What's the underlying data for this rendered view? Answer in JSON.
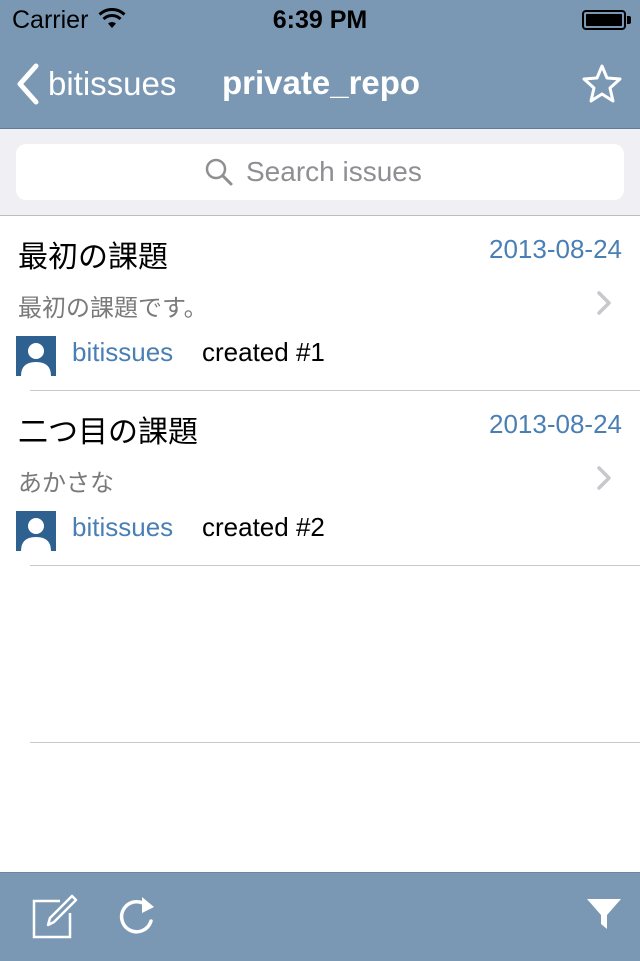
{
  "status_bar": {
    "carrier": "Carrier",
    "time": "6:39 PM",
    "wifi_icon": "wifi-icon",
    "battery_icon": "battery-icon"
  },
  "nav": {
    "back_label": "bitissues",
    "title": "private_repo",
    "back_icon": "chevron-left-icon",
    "star_icon": "star-icon"
  },
  "search": {
    "placeholder": "Search issues",
    "value": ""
  },
  "issues": [
    {
      "title": "最初の課題",
      "date": "2013-08-24",
      "description": "最初の課題です。",
      "user": "bitissues",
      "action": "created #1"
    },
    {
      "title": "二つ目の課題",
      "date": "2013-08-24",
      "description": "あかさな",
      "user": "bitissues",
      "action": "created #2"
    }
  ],
  "toolbar": {
    "compose_icon": "compose-icon",
    "refresh_icon": "refresh-icon",
    "filter_icon": "filter-icon"
  },
  "colors": {
    "bar_background": "#7a98b4",
    "link_blue": "#4a7fb5",
    "avatar_blue": "#2e6090"
  }
}
